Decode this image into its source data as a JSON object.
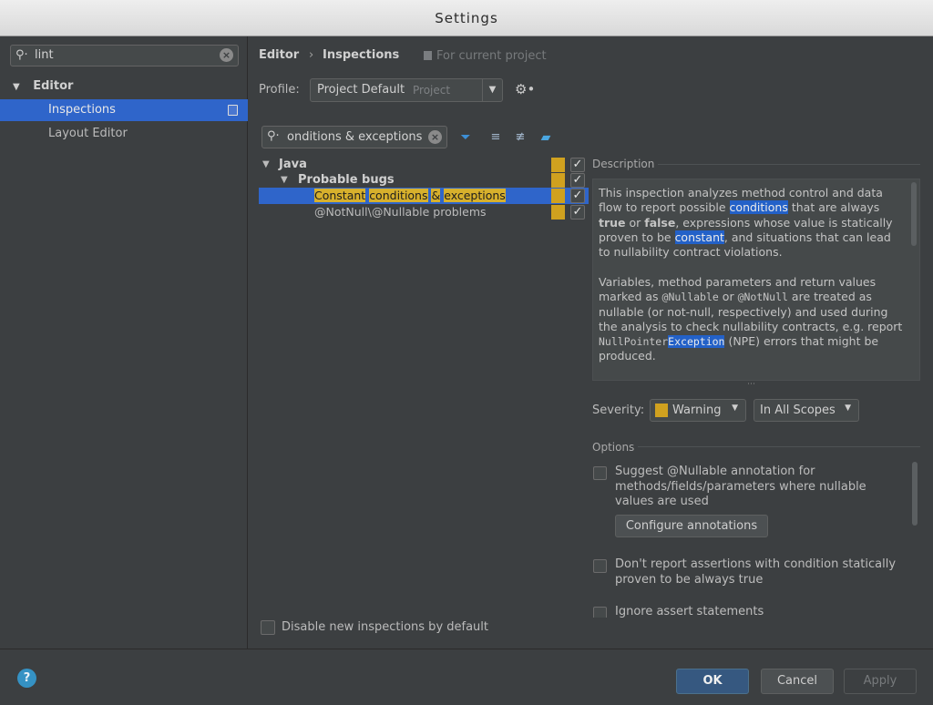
{
  "window": {
    "title": "Settings"
  },
  "sidebar": {
    "search": {
      "value": "lint"
    },
    "group": {
      "label": "Editor"
    },
    "items": [
      {
        "label": "Inspections"
      },
      {
        "label": "Layout Editor"
      }
    ]
  },
  "header": {
    "breadcrumb": {
      "section": "Editor",
      "separator": "›",
      "page": "Inspections"
    },
    "scope_note": "For current project",
    "profile": {
      "label": "Profile:",
      "value": "Project Default",
      "type": "Project"
    }
  },
  "filter": {
    "value": "onditions & exceptions"
  },
  "tree": {
    "java": "Java",
    "probable_bugs": "Probable bugs",
    "selected": {
      "w1": "Constant",
      "w2": "conditions",
      "sep": "&",
      "w3": "exceptions"
    },
    "nullable": "@NotNull\\@Nullable problems"
  },
  "description": {
    "title": "Description",
    "p1": {
      "a": "This inspection analyzes method control and data flow to report possible ",
      "hl1": "conditions",
      "b": " that are always ",
      "true": "true",
      "c": " or ",
      "false": "false",
      "d": ", expressions whose value is statically proven to be ",
      "hl2": "constant",
      "e": ", and situations that can lead to nullability contract violations."
    },
    "p2": {
      "a": "Variables, method parameters and return values marked as ",
      "nullable": "@Nullable",
      "b": " or ",
      "notnull": "@NotNull",
      "c": " are treated as nullable (or not-null, respectively) and used during the analysis to check nullability contracts, e.g. report ",
      "npe1": "NullPointer",
      "npe2": "Exception",
      "npe3": "ion",
      "d": " (NPE) errors that might be produced."
    }
  },
  "severity": {
    "label": "Severity:",
    "value": "Warning",
    "scope": "In All Scopes",
    "color": "#d0a11f"
  },
  "options": {
    "title": "Options",
    "opt1": "Suggest @Nullable annotation for methods/fields/parameters where nullable values are used",
    "configure": "Configure annotations",
    "opt2": "Don't report assertions with condition statically proven to be always true",
    "opt3": "Ignore assert statements"
  },
  "disable_new": "Disable new inspections by default",
  "buttons": {
    "help": "?",
    "ok": "OK",
    "cancel": "Cancel",
    "apply": "Apply"
  },
  "colors": {
    "accent": "#2f65ca",
    "highlight": "#d7b02c",
    "warning": "#d0a11f"
  }
}
